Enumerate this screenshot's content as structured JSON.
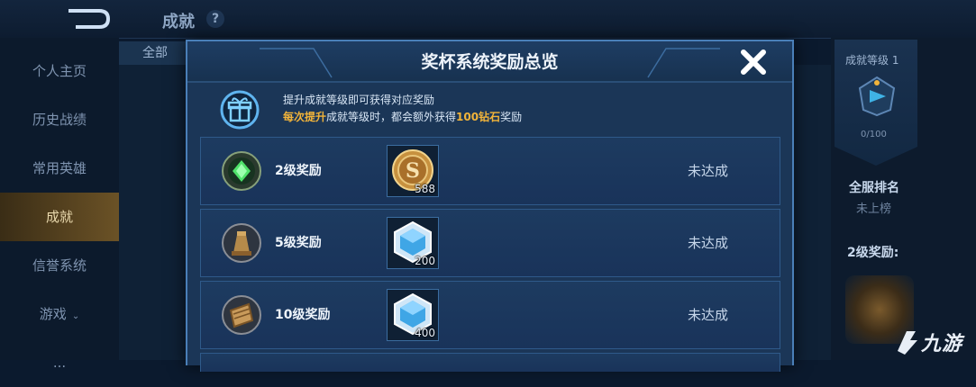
{
  "app": {
    "page_title": "成就",
    "help_symbol": "?",
    "filter_label": "全部"
  },
  "sidebar": {
    "items": [
      {
        "label": "个人主页"
      },
      {
        "label": "历史战绩"
      },
      {
        "label": "常用英雄"
      },
      {
        "label": "成就",
        "active": true
      },
      {
        "label": "信誉系统"
      },
      {
        "label": "游戏",
        "caret": "⌄"
      },
      {
        "label": "..."
      }
    ]
  },
  "right_panel": {
    "level_label": "成就等级 1",
    "progress": "0/100",
    "server_rank_title": "全服排名",
    "server_rank_value": "未上榜",
    "reward_label": "2级奖励:"
  },
  "watermark": "九游",
  "modal": {
    "title": "奖杯系统奖励总览",
    "close_icon": "close-x-icon",
    "notice": {
      "line1": "提升成就等级即可获得对应奖励",
      "line2_hl1": "每次提升",
      "line2_a": "成就等级时，都会额外获得",
      "line2_hl2": "100钻石",
      "line2_b": "奖励"
    },
    "rows": [
      {
        "label": "2级奖励",
        "emblem": "green-gem-emblem-icon",
        "item": "gold-coin-icon",
        "qty": "588",
        "status": "未达成"
      },
      {
        "label": "5级奖励",
        "emblem": "bronze-trophy-emblem-icon",
        "item": "diamond-crystal-icon",
        "qty": "200",
        "status": "未达成"
      },
      {
        "label": "10级奖励",
        "emblem": "wooden-frame-emblem-icon",
        "item": "diamond-crystal-icon",
        "qty": "400",
        "status": "未达成"
      }
    ]
  },
  "colors": {
    "accent_gold": "#f2b43a",
    "modal_border": "#4a7fb8",
    "active_tab": "#6b5226"
  }
}
